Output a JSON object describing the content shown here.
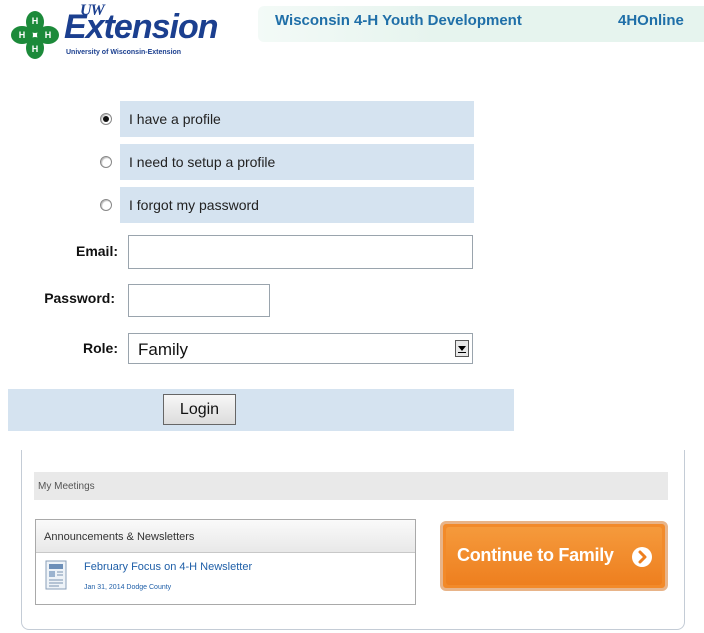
{
  "header": {
    "logo_uw": "UW",
    "logo_extension": "Extension",
    "logo_subtitle": "University of Wisconsin-Extension",
    "title": "Wisconsin 4-H Youth Development",
    "link": "4HOnline",
    "icons": {
      "logo": "four-leaf-clover-icon"
    },
    "colors": {
      "brand_green": "#1c8a3a",
      "brand_blue": "#1b3f8f",
      "header_text": "#1f6fa8"
    }
  },
  "login_options": [
    {
      "label": "I have a profile",
      "selected": true
    },
    {
      "label": "I need to setup a profile",
      "selected": false
    },
    {
      "label": "I forgot my password",
      "selected": false
    }
  ],
  "form": {
    "email_label": "Email:",
    "email_value": "",
    "password_label": "Password:",
    "password_value": "",
    "role_label": "Role:",
    "role_value": "Family",
    "login_button": "Login"
  },
  "panel": {
    "meetings_label": "My Meetings",
    "announcements_title": "Announcements & Newsletters",
    "newsletter": {
      "title": "February Focus on 4-H Newsletter",
      "meta": "Jan 31, 2014 Dodge County",
      "icon": "document-icon"
    },
    "continue_button": "Continue to Family",
    "continue_icon": "circle-arrow-right-icon",
    "colors": {
      "continue_orange": "#f28a2a",
      "link_blue": "#1f5fa8"
    }
  }
}
